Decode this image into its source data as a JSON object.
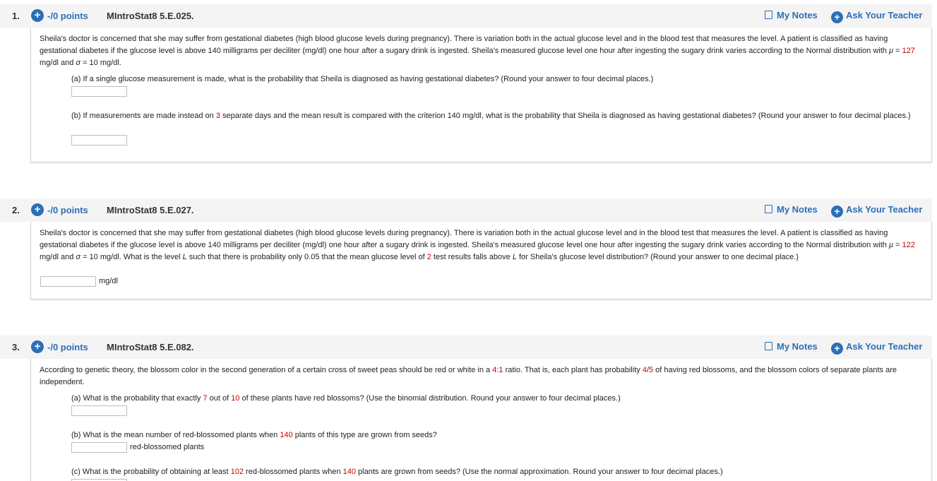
{
  "header": {
    "my_notes": "My Notes",
    "ask_teacher": "Ask Your Teacher",
    "plus_icon": "+"
  },
  "q1": {
    "number": "1.",
    "points": "-/0 points",
    "id": "MIntroStat8 5.E.025.",
    "intro_a": "Sheila's doctor is concerned that she may suffer from gestational diabetes (high blood glucose levels during pregnancy). There is variation both in the actual glucose level and in the blood test that measures the level. A patient is classified as having gestational diabetes if the glucose level is above 140 milligrams per deciliter (mg/dl) one hour after a sugary drink is ingested. Sheila's measured glucose level one hour after ingesting the sugary drink varies according to the Normal distribution with ",
    "mu_sym": "μ",
    "eq1": " = ",
    "mu_val": "127",
    "intro_b": " mg/dl and ",
    "sigma_sym": "σ",
    "eq2": " = 10 mg/dl.",
    "a_text": "(a) If a single glucose measurement is made, what is the probability that Sheila is diagnosed as having gestational diabetes? (Round your answer to four decimal places.)",
    "b_pre": "(b) If measurements are made instead on ",
    "b_days": "3",
    "b_post": " separate days and the mean result is compared with the criterion 140 mg/dl, what is the probability that Sheila is diagnosed as having gestational diabetes? (Round your answer to four decimal places.)"
  },
  "q2": {
    "number": "2.",
    "points": "-/0 points",
    "id": "MIntroStat8 5.E.027.",
    "intro_a": "Sheila's doctor is concerned that she may suffer from gestational diabetes (high blood glucose levels during pregnancy). There is variation both in the actual glucose level and in the blood test that measures the level. A patient is classified as having gestational diabetes if the glucose level is above 140 milligrams per deciliter (mg/dl) one hour after a sugary drink is ingested. Sheila's measured glucose level one hour after ingesting the sugary drink varies according to the Normal distribution with ",
    "mu_sym": "μ",
    "eq1": " = ",
    "mu_val": "122",
    "intro_b": " mg/dl and ",
    "sigma_sym": "σ",
    "intro_c": " = 10 mg/dl. What is the level ",
    "L1": "L",
    "intro_d": " such that there is probability only 0.05 that the mean glucose level of ",
    "n_val": "2",
    "intro_e": " test results falls above ",
    "L2": "L",
    "intro_f": " for Sheila's glucose level distribution? (Round your answer to one decimal place.)",
    "unit": "mg/dl"
  },
  "q3": {
    "number": "3.",
    "points": "-/0 points",
    "id": "MIntroStat8 5.E.082.",
    "intro_a": "According to genetic theory, the blossom color in the second generation of a certain cross of sweet peas should be red or white in a ",
    "ratio": "4:1",
    "intro_b": " ratio. That is, each plant has probability ",
    "p_num": "4",
    "p_slash": "/",
    "p_den": "5",
    "intro_c": " of having red blossoms, and the blossom colors of separate plants are independent.",
    "a_pre": "(a) What is the probability that exactly ",
    "a_k": "7",
    "a_mid": " out of ",
    "a_n": "10",
    "a_post": " of these plants have red blossoms? (Use the binomial distribution. Round your answer to four decimal places.)",
    "b_pre": "(b) What is the mean number of red-blossomed plants when ",
    "b_n": "140",
    "b_post": " plants of this type are grown from seeds?",
    "b_unit": "red-blossomed plants",
    "c_pre": "(c) What is the probability of obtaining at least ",
    "c_k": "102",
    "c_mid": " red-blossomed plants when ",
    "c_n": "140",
    "c_post": " plants are grown from seeds? (Use the normal approximation. Round your answer to four decimal places.)"
  }
}
